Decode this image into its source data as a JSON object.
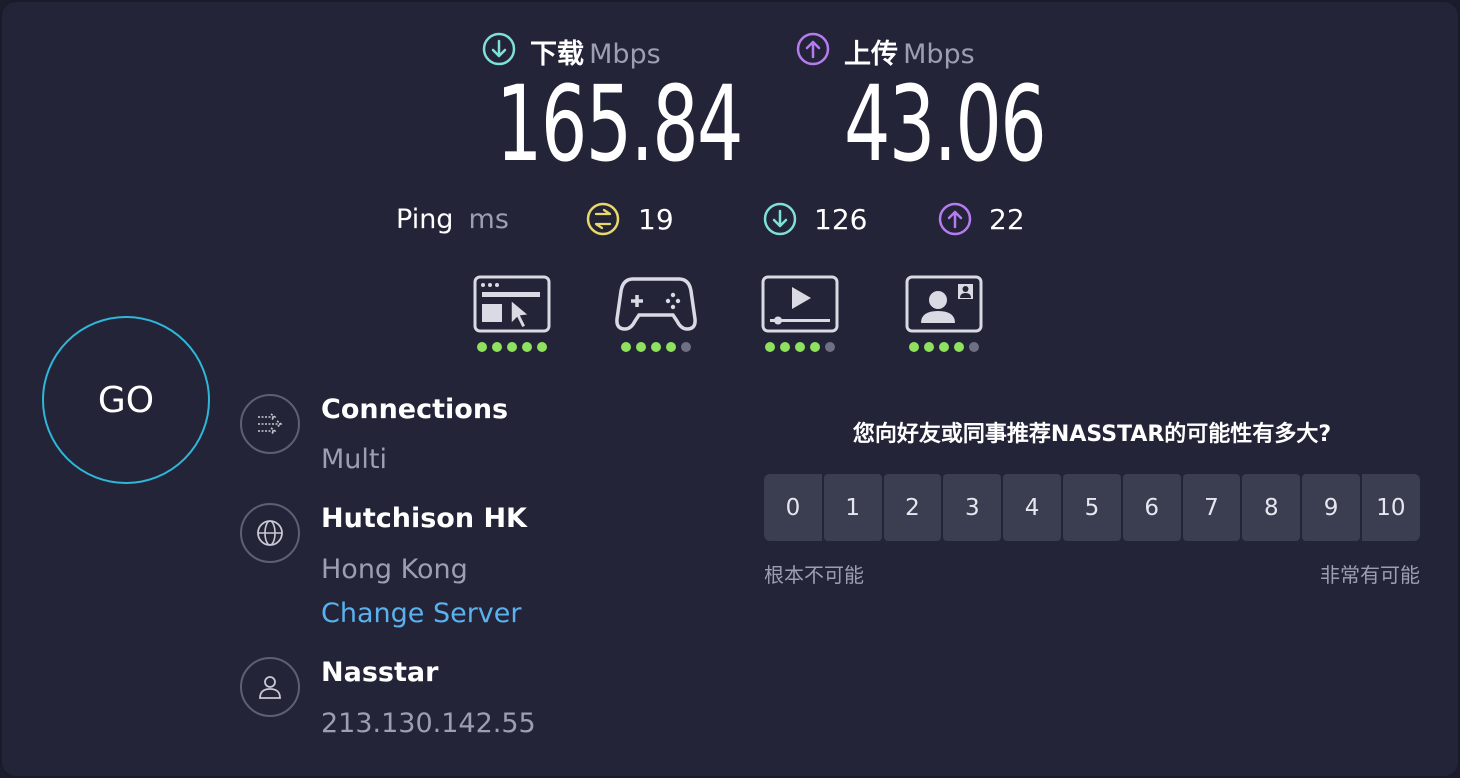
{
  "header": {
    "download": {
      "label": "下载",
      "unit": "Mbps",
      "value": "165.84",
      "icon": "arrow-down-circle-icon",
      "color": "#7fe0d8"
    },
    "upload": {
      "label": "上传",
      "unit": "Mbps",
      "value": "43.06",
      "icon": "arrow-up-circle-icon",
      "color": "#b57cf0"
    }
  },
  "ping": {
    "label": "Ping",
    "unit": "ms",
    "idle": {
      "value": "19",
      "icon": "jitter-icon",
      "color": "#e9d86a"
    },
    "download": {
      "value": "126",
      "icon": "arrow-down-circle-icon",
      "color": "#7fe0d8"
    },
    "upload": {
      "value": "22",
      "icon": "arrow-up-circle-icon",
      "color": "#b57cf0"
    }
  },
  "quality": [
    {
      "icon": "web-browsing-icon",
      "rating": 5,
      "max": 5
    },
    {
      "icon": "gaming-controller-icon",
      "rating": 4,
      "max": 5
    },
    {
      "icon": "video-streaming-icon",
      "rating": 4,
      "max": 5
    },
    {
      "icon": "video-call-icon",
      "rating": 4,
      "max": 5
    }
  ],
  "go_button": {
    "label": "GO"
  },
  "connections": {
    "title": "Connections",
    "value": "Multi",
    "icon": "connections-icon"
  },
  "server": {
    "title": "Hutchison HK",
    "location": "Hong Kong",
    "change_label": "Change Server",
    "icon": "globe-icon"
  },
  "provider": {
    "title": "Nasstar",
    "ip": "213.130.142.55",
    "icon": "user-icon"
  },
  "survey": {
    "question": "您向好友或同事推荐NASSTAR的可能性有多大?",
    "options": [
      "0",
      "1",
      "2",
      "3",
      "4",
      "5",
      "6",
      "7",
      "8",
      "9",
      "10"
    ],
    "low_label": "根本不可能",
    "high_label": "非常有可能"
  },
  "colors": {
    "background": "#232437",
    "accent_go": "#2fb6d8",
    "link": "#5ab1ef",
    "rating_on": "#8ee25e",
    "rating_off": "#6e7083"
  }
}
